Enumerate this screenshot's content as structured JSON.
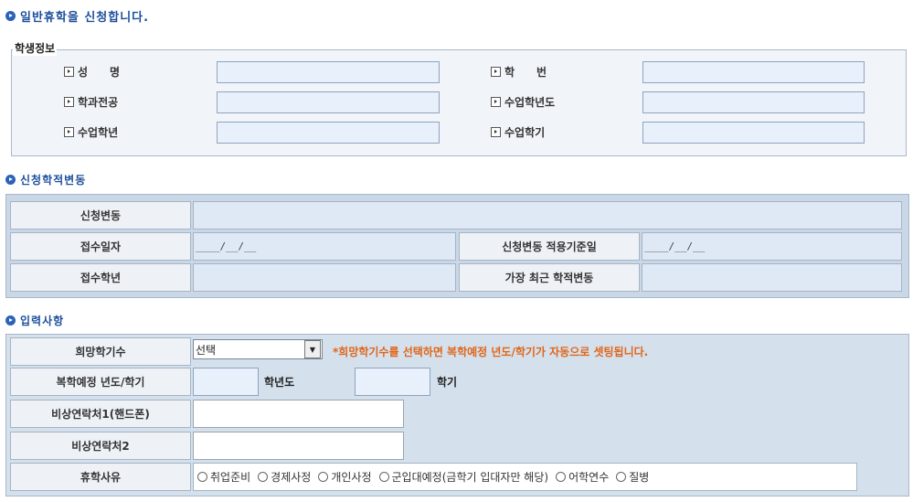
{
  "page_title": "일반휴학을 신청합니다.",
  "student_info": {
    "legend": "학생정보",
    "fields": {
      "name": "성　　명",
      "student_no": "학　　번",
      "dept": "학과전공",
      "year": "수업학년도",
      "grade": "수업학년",
      "semester": "수업학기"
    }
  },
  "status_change": {
    "title": "신청학적변동",
    "request_change": "신청변동",
    "receipt_date": "접수일자",
    "receipt_date_value": "____/__/__",
    "apply_date": "신청변동 적용기준일",
    "apply_date_value": "____/__/__",
    "receipt_grade": "접수학년",
    "latest_change": "가장 최근 학적변동"
  },
  "input_section": {
    "title": "입력사항",
    "desired_semesters": "희망학기수",
    "select_value": "선택",
    "notice": "*희망학기수를 선택하면 복학예정 년도/학기가 자동으로 셋팅됩니다.",
    "return_plan": "복학예정 년도/학기",
    "year_suffix": "학년도",
    "semester_suffix": "학기",
    "contact1": "비상연락처1(핸드폰)",
    "contact2": "비상연락처2",
    "reason": "휴학사유",
    "reasons": [
      "취업준비",
      "경제사정",
      "개인사정",
      "군입대예정(금학기 입대자만 해당)",
      "어학연수",
      "질병"
    ]
  }
}
